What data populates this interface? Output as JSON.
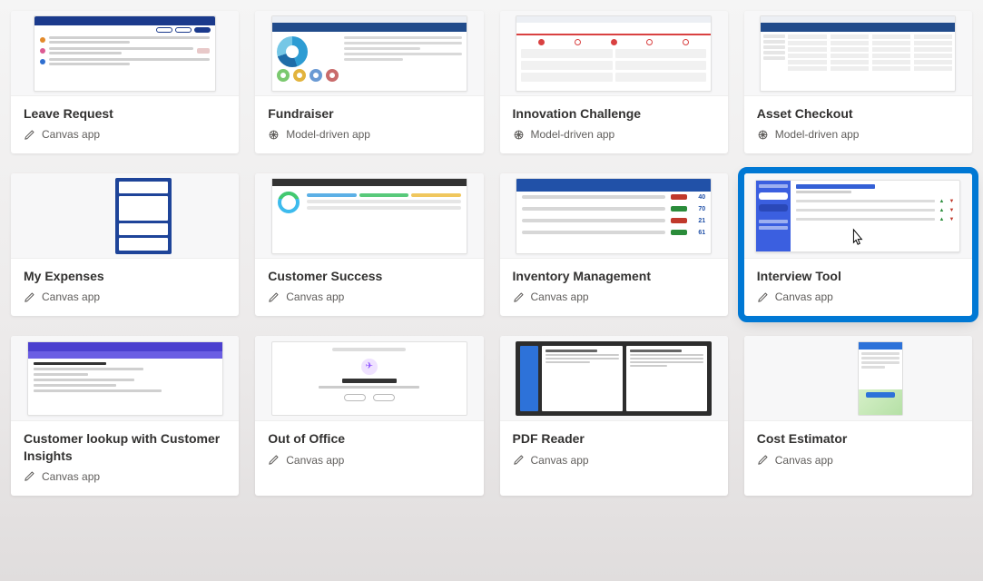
{
  "templates": [
    {
      "title": "Leave Request",
      "type_label": "Canvas app",
      "type_kind": "canvas",
      "thumb": "leave",
      "selected": false
    },
    {
      "title": "Fundraiser",
      "type_label": "Model-driven app",
      "type_kind": "model",
      "thumb": "fund",
      "selected": false
    },
    {
      "title": "Innovation Challenge",
      "type_label": "Model-driven app",
      "type_kind": "model",
      "thumb": "inno",
      "selected": false
    },
    {
      "title": "Asset Checkout",
      "type_label": "Model-driven app",
      "type_kind": "model",
      "thumb": "asset",
      "selected": false
    },
    {
      "title": "My Expenses",
      "type_label": "Canvas app",
      "type_kind": "canvas",
      "thumb": "exp",
      "selected": false
    },
    {
      "title": "Customer Success",
      "type_label": "Canvas app",
      "type_kind": "canvas",
      "thumb": "cs",
      "selected": false
    },
    {
      "title": "Inventory Management",
      "type_label": "Canvas app",
      "type_kind": "canvas",
      "thumb": "inv",
      "selected": false
    },
    {
      "title": "Interview Tool",
      "type_label": "Canvas app",
      "type_kind": "canvas",
      "thumb": "int",
      "selected": true
    },
    {
      "title": "Customer lookup with Customer Insights",
      "type_label": "Canvas app",
      "type_kind": "canvas",
      "thumb": "cl",
      "selected": false
    },
    {
      "title": "Out of Office",
      "type_label": "Canvas app",
      "type_kind": "canvas",
      "thumb": "ooo",
      "selected": false
    },
    {
      "title": "PDF Reader",
      "type_label": "Canvas app",
      "type_kind": "canvas",
      "thumb": "pdf",
      "selected": false
    },
    {
      "title": "Cost Estimator",
      "type_label": "Canvas app",
      "type_kind": "canvas",
      "thumb": "ce",
      "selected": false
    }
  ],
  "inventory_rows": [
    {
      "badge_color": "#c0392b",
      "num": "40"
    },
    {
      "badge_color": "#2a8c3a",
      "num": "70"
    },
    {
      "badge_color": "#c0392b",
      "num": "21"
    },
    {
      "badge_color": "#2a8c3a",
      "num": "61"
    }
  ]
}
